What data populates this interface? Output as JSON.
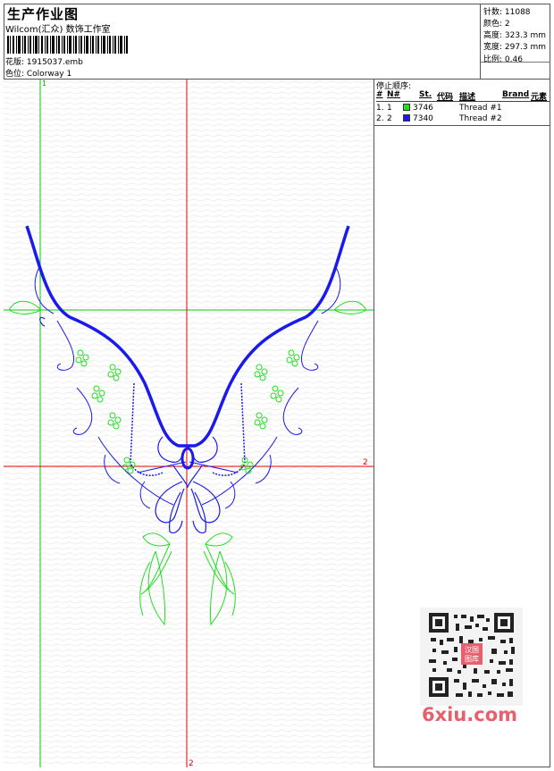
{
  "header": {
    "title": "生产作业图",
    "subtitle": "Wilcom(汇众) 数饰工作室",
    "design_label": "花版: 1915037.emb",
    "colorway_label": "色位:   Colorway 1"
  },
  "stats": {
    "stitches": "针数: 11088",
    "colors": "颜色: 2",
    "height": "高度: 323.3 mm",
    "width": "宽度: 297.3 mm",
    "scale": "比例: 0.46"
  },
  "stop_sequence": {
    "heading": "停止顺序:",
    "columns": {
      "num": "#",
      "n": "N#",
      "st": "St.",
      "code": "代码",
      "desc": "描述",
      "brand": "Brand",
      "element": "元素"
    },
    "rows": [
      {
        "index": "1.",
        "n": "1",
        "code": "3746",
        "desc": "Thread #1",
        "color": "#22dd22"
      },
      {
        "index": "2.",
        "n": "2",
        "code": "7340",
        "desc": "Thread #2",
        "color": "#1a1aee"
      }
    ]
  },
  "canvas": {
    "guide_label_v1": "1",
    "guide_label_h2": "2",
    "guide_label_v2_bottom": "2",
    "thread_color_1": "#22dd22",
    "thread_color_2": "#1a1aee",
    "guide_green": "#00cc00",
    "guide_red": "#dd0000"
  },
  "watermark": {
    "text": "6xiu.com",
    "stamp_text": "汉国图库"
  }
}
